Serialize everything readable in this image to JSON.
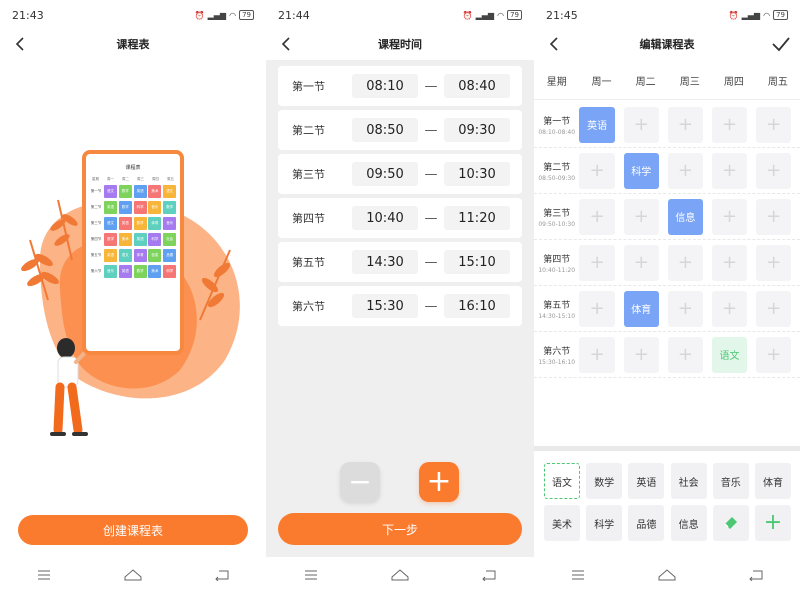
{
  "status_icons": {
    "alarm": "⏰",
    "wifi": "wifi-icon",
    "battery": "79"
  },
  "screen1": {
    "time": "21:43",
    "title": "课程表",
    "create_button": "创建课程表",
    "phone": {
      "title": "课程表",
      "days": [
        "星期",
        "周一",
        "周二",
        "周三",
        "周四",
        "周五"
      ],
      "periods": [
        "第一节",
        "第二节",
        "第三节",
        "第四节",
        "第五节",
        "第六节"
      ],
      "subjects": [
        [
          "语文",
          "数学",
          "英语",
          "美术",
          "语文"
        ],
        [
          "英语",
          "数学",
          "科学",
          "音乐",
          "数学"
        ],
        [
          "语文",
          "英语",
          "数学",
          "体育",
          "音乐"
        ],
        [
          "数学",
          "美术",
          "英语",
          "科学",
          "社会"
        ],
        [
          "英语",
          "语文",
          "体育",
          "信息",
          "品德"
        ],
        [
          "音乐",
          "英语",
          "数学",
          "美术",
          "科学"
        ]
      ]
    }
  },
  "screen2": {
    "time": "21:44",
    "title": "课程时间",
    "rows": [
      {
        "label": "第一节",
        "start": "08:10",
        "end": "08:40"
      },
      {
        "label": "第二节",
        "start": "08:50",
        "end": "09:30"
      },
      {
        "label": "第三节",
        "start": "09:50",
        "end": "10:30"
      },
      {
        "label": "第四节",
        "start": "10:40",
        "end": "11:20"
      },
      {
        "label": "第五节",
        "start": "14:30",
        "end": "15:10"
      },
      {
        "label": "第六节",
        "start": "15:30",
        "end": "16:10"
      }
    ],
    "separator": "—",
    "minus": "−",
    "plus": "+",
    "next_button": "下一步"
  },
  "screen3": {
    "time": "21:45",
    "title": "编辑课程表",
    "header": [
      "星期",
      "周一",
      "周二",
      "周三",
      "周四",
      "周五"
    ],
    "periods": [
      {
        "name": "第一节",
        "time": "08:10-08:40"
      },
      {
        "name": "第二节",
        "time": "08:50-09:30"
      },
      {
        "name": "第三节",
        "time": "09:50-10:30"
      },
      {
        "name": "第四节",
        "time": "10:40-11:20"
      },
      {
        "name": "第五节",
        "time": "14:30-15:10"
      },
      {
        "name": "第六节",
        "time": "15:30-16:10"
      }
    ],
    "grid": [
      [
        "英语",
        "",
        "",
        "",
        ""
      ],
      [
        "",
        "科学",
        "",
        "",
        ""
      ],
      [
        "",
        "",
        "信息",
        "",
        ""
      ],
      [
        "",
        "",
        "",
        "",
        ""
      ],
      [
        "",
        "体育",
        "",
        "",
        ""
      ],
      [
        "",
        "",
        "",
        "语文",
        ""
      ]
    ],
    "palette": [
      "语文",
      "数学",
      "英语",
      "社会",
      "音乐",
      "体育",
      "美术",
      "科学",
      "品德",
      "信息",
      "eraser-icon",
      "add-icon"
    ],
    "colors": {
      "accent": "#fa7b2e",
      "blue": "#7aa4f5",
      "green_bg": "#e2f7ea",
      "green_text": "#4cc774"
    }
  }
}
